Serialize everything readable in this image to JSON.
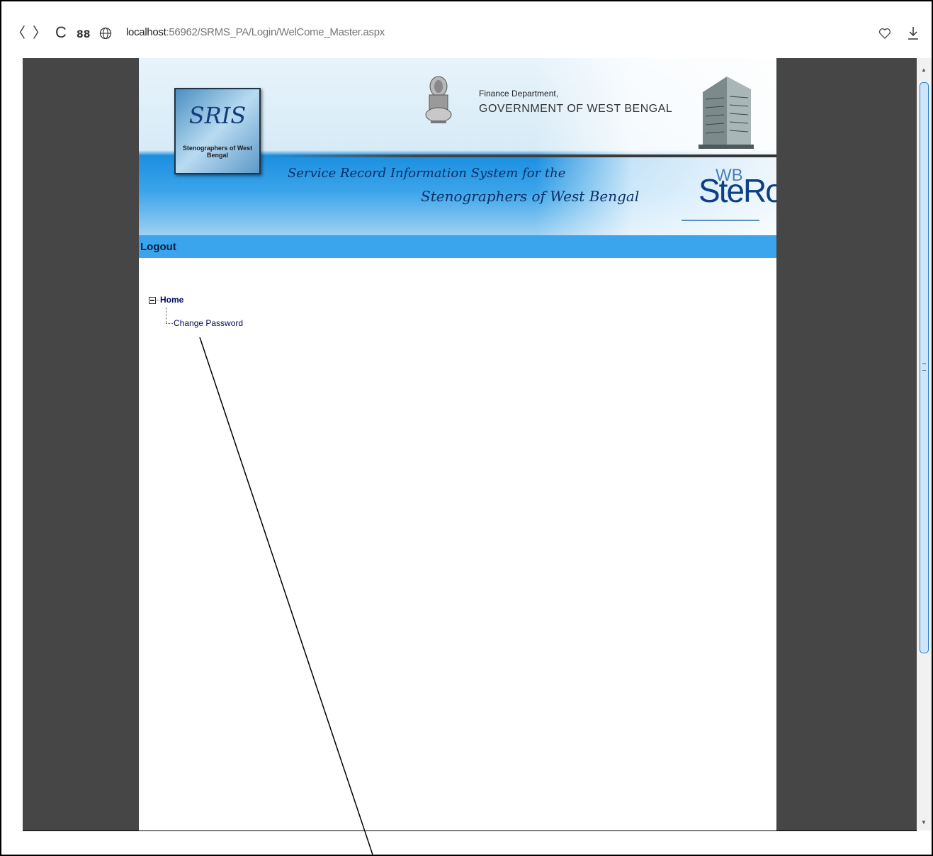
{
  "browser": {
    "back_glyph": "〈",
    "forward_glyph": "〉",
    "reload_glyph": "C",
    "apps_glyph": "88",
    "url_host": "localhost",
    "url_rest": ":56962/SRMS_PA/Login/WelCome_Master.aspx",
    "icons": [
      "back-icon",
      "forward-icon",
      "reload-icon",
      "apps-icon",
      "globe-icon",
      "heart-icon",
      "download-icon"
    ]
  },
  "header": {
    "logo_text": "SRIS",
    "logo_ring_text": "Stenographers of West Bengal",
    "dept_line1": "Finance Department,",
    "dept_line2": "GOVERNMENT OF WEST BENGAL",
    "tagline_line1": "Service Record Information System for the",
    "tagline_line2": "Stenographers of West Bengal",
    "brand": "SteRo",
    "brand_sup": "WB"
  },
  "menu": {
    "logout_label": "Logout"
  },
  "tree": {
    "root_label": "Home",
    "children": [
      {
        "label": "Change Password"
      }
    ]
  },
  "colors": {
    "menubar": "#3aa4ec",
    "page_bg": "#464646",
    "link_color": "#000b5c"
  }
}
